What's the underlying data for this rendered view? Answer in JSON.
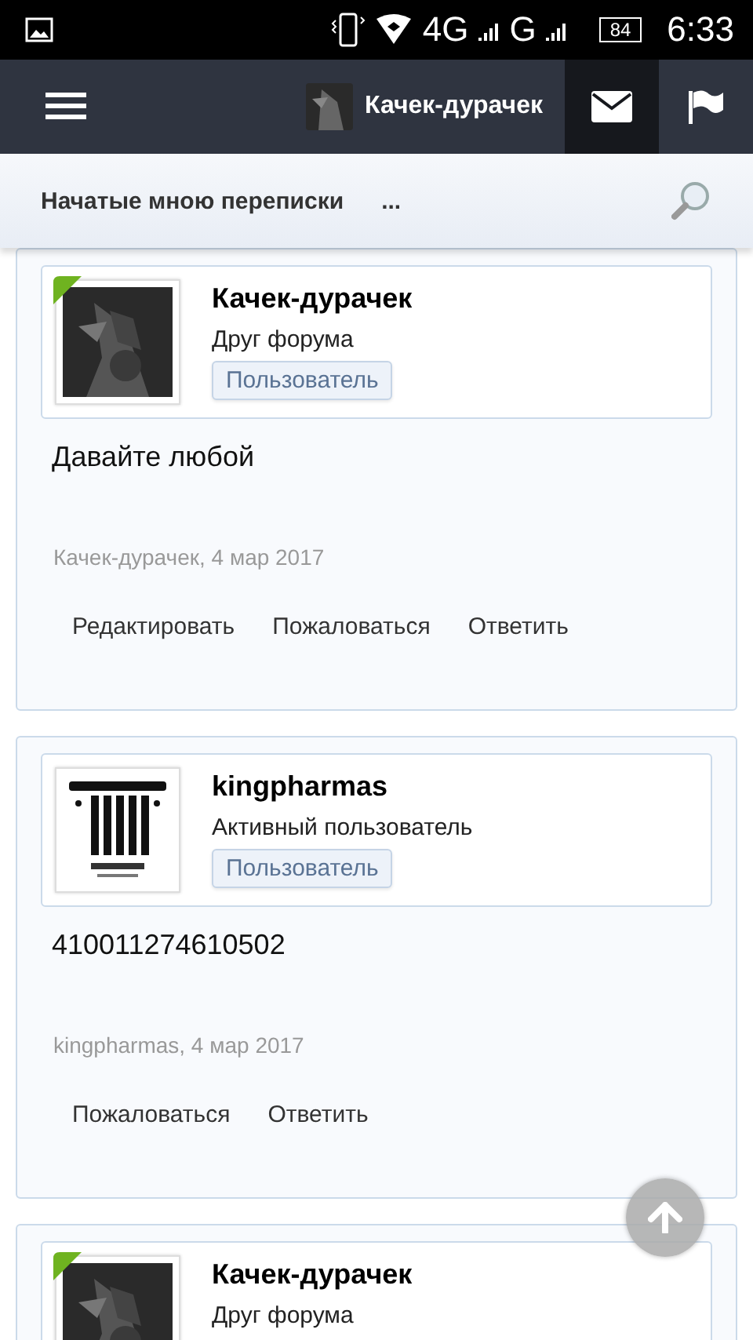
{
  "status_bar": {
    "network_4g": "4G",
    "network_g": "G",
    "battery": "84",
    "time": "6:33"
  },
  "header": {
    "username": "Качек-дурачек",
    "messages_active": true
  },
  "subbar": {
    "title": "Начатые мною переписки",
    "more": "..."
  },
  "posts": [
    {
      "author": "Качек-дурачек",
      "title": "Друг форума",
      "badge": "Пользователь",
      "online": true,
      "avatar": {
        "kind": "picture"
      },
      "message": "Давайте любой",
      "meta": "Качек-дурачек, 4 мар 2017",
      "actions": [
        "Редактировать",
        "Пожаловаться",
        "Ответить"
      ]
    },
    {
      "author": "kingpharmas",
      "title": "Активный пользователь",
      "badge": "Пользователь",
      "online": false,
      "avatar": {
        "kind": "picture"
      },
      "message": "410011274610502",
      "meta": "kingpharmas, 4 мар 2017",
      "actions": [
        "Пожаловаться",
        "Ответить"
      ]
    },
    {
      "author": "Качек-дурачек",
      "title": "Друг форума",
      "online": true,
      "avatar": {
        "kind": "picture"
      }
    }
  ]
}
